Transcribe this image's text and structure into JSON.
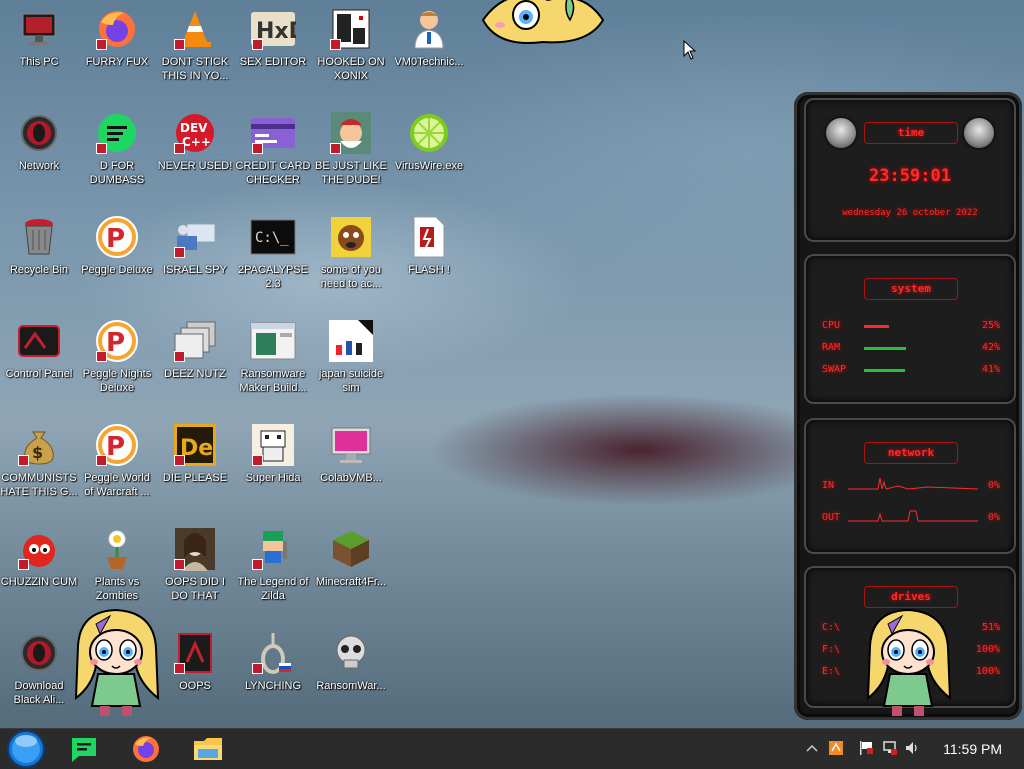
{
  "desktop_icons": [
    {
      "id": "this-pc",
      "label": "This PC",
      "icon": "monitor-icon",
      "shortcut": false
    },
    {
      "id": "furry-fux",
      "label": "FURRY FUX",
      "icon": "firefox-icon",
      "shortcut": true
    },
    {
      "id": "dont-stick",
      "label": "DONT STICK THIS IN YO...",
      "icon": "vlc-cone-icon",
      "shortcut": true
    },
    {
      "id": "sex-editor",
      "label": "SEX EDITOR",
      "icon": "hxd-editor-icon",
      "shortcut": true
    },
    {
      "id": "hooked-on-xonix",
      "label": "HOOKED ON XONIX",
      "icon": "xonix-game-icon",
      "shortcut": true
    },
    {
      "id": "vm0technic",
      "label": "VM0Technic...",
      "icon": "doctor-icon",
      "shortcut": false
    },
    {
      "id": "network",
      "label": "Network",
      "icon": "alienware-orb-icon",
      "shortcut": false
    },
    {
      "id": "d-for-dumbass",
      "label": "D FOR DUMBASS",
      "icon": "green-chat-icon",
      "shortcut": true
    },
    {
      "id": "never-used",
      "label": "NEVER USED!",
      "icon": "devcpp-icon",
      "shortcut": true
    },
    {
      "id": "credit-card-checker",
      "label": "CREDIT CARD CHECKER",
      "icon": "credit-card-icon",
      "shortcut": true
    },
    {
      "id": "be-just-like-dude",
      "label": "BE JUST LIKE THE DUDE!",
      "icon": "santa-icon",
      "shortcut": true
    },
    {
      "id": "viruswire",
      "label": "VirusWire.exe",
      "icon": "lime-icon",
      "shortcut": false
    },
    {
      "id": "recycle-bin",
      "label": "Recycle Bin",
      "icon": "trash-bin-icon",
      "shortcut": false
    },
    {
      "id": "peggle-deluxe",
      "label": "Peggle Deluxe",
      "icon": "peggle-icon",
      "shortcut": false
    },
    {
      "id": "israel-spy",
      "label": "ISRAEL SPY",
      "icon": "spy-computer-icon",
      "shortcut": true
    },
    {
      "id": "2pacalypse",
      "label": "2PACALYPSE 2.3",
      "icon": "terminal-icon",
      "shortcut": false
    },
    {
      "id": "some-of-you",
      "label": "some of you need to ac...",
      "icon": "dog-icon",
      "shortcut": false
    },
    {
      "id": "flash",
      "label": "FLASH !",
      "icon": "flash-document-icon",
      "shortcut": false
    },
    {
      "id": "control-panel",
      "label": "Control Panel",
      "icon": "alienware-panel-icon",
      "shortcut": false
    },
    {
      "id": "peggle-nights",
      "label": "Peggle Nights Deluxe",
      "icon": "peggle-icon",
      "shortcut": true
    },
    {
      "id": "deez-nutz",
      "label": "DEEZ NUTZ",
      "icon": "stacked-windows-icon",
      "shortcut": true
    },
    {
      "id": "ransomware-maker",
      "label": "Ransomware Maker Build...",
      "icon": "window-icon",
      "shortcut": false
    },
    {
      "id": "japan-suicide-sim",
      "label": "japan suicide sim",
      "icon": "figures-icon",
      "shortcut": false
    },
    {
      "id": "communists",
      "label": "COMMUNISTS HATE THIS G...",
      "icon": "money-bag-icon",
      "shortcut": true
    },
    {
      "id": "peggle-wow",
      "label": "Peggle World of Warcraft ...",
      "icon": "peggle-icon",
      "shortcut": true
    },
    {
      "id": "die-please",
      "label": "DIE PLEASE",
      "icon": "de-icon",
      "shortcut": true
    },
    {
      "id": "super-hida",
      "label": "Super Hida",
      "icon": "pixel-character-icon",
      "shortcut": true
    },
    {
      "id": "colabvmb",
      "label": "ColabVMB...",
      "icon": "pink-monitor-icon",
      "shortcut": false
    },
    {
      "id": "chuzzin-cum",
      "label": "CHUZZIN CUM",
      "icon": "red-chuzzle-icon",
      "shortcut": true
    },
    {
      "id": "plants-vs-zombies",
      "label": "Plants vs Zombies",
      "icon": "flower-pot-icon",
      "shortcut": false
    },
    {
      "id": "oops-did-i",
      "label": "OOPS DID I DO THAT",
      "icon": "portrait-icon",
      "shortcut": true
    },
    {
      "id": "legend-of-zilda",
      "label": "The Legend of Zilda",
      "icon": "pixel-hero-icon",
      "shortcut": true
    },
    {
      "id": "minecraft",
      "label": "Minecraft4Fr...",
      "icon": "grass-block-icon",
      "shortcut": false
    },
    {
      "id": "download-black-ali",
      "label": "Download Black Ali...",
      "icon": "alienware-orb-icon",
      "shortcut": false
    },
    {
      "id": "oops",
      "label": "OOPS",
      "icon": "red-app-icon",
      "shortcut": true
    },
    {
      "id": "lynching",
      "label": "LYNCHING",
      "icon": "noose-icon",
      "shortcut": true
    },
    {
      "id": "ransomwar",
      "label": "RansomWar...",
      "icon": "skull-icon",
      "shortcut": false
    }
  ],
  "widget": {
    "time": {
      "title": "time",
      "clock": "23:59:01",
      "date": "wednesday 26 october 2022"
    },
    "system": {
      "title": "system",
      "rows": [
        {
          "key": "CPU",
          "value": "25%",
          "level": 0.25
        },
        {
          "key": "RAM",
          "value": "42%",
          "level": 0.42
        },
        {
          "key": "SWAP",
          "value": "41%",
          "level": 0.41
        }
      ]
    },
    "network": {
      "title": "network",
      "rows": [
        {
          "key": "IN",
          "value": "0%"
        },
        {
          "key": "OUT",
          "value": "0%"
        }
      ]
    },
    "drives": {
      "title": "drives",
      "rows": [
        {
          "key": "C:\\",
          "value": "51%"
        },
        {
          "key": "F:\\",
          "value": "100%"
        },
        {
          "key": "E:\\",
          "value": "100%"
        }
      ]
    }
  },
  "taskbar": {
    "pinned": [
      {
        "id": "start",
        "icon": "start-orb-icon"
      },
      {
        "id": "chat",
        "icon": "green-chat-icon"
      },
      {
        "id": "firefox",
        "icon": "firefox-icon"
      },
      {
        "id": "explorer",
        "icon": "folder-icon"
      }
    ],
    "tray": [
      "chevron-up-icon",
      "orange-app-icon",
      "flag-icon",
      "network-icon",
      "volume-icon"
    ],
    "clock": "11:59 PM"
  },
  "colors": {
    "accent_red": "#ff2a2a",
    "taskbar": "#2b2b2b"
  }
}
